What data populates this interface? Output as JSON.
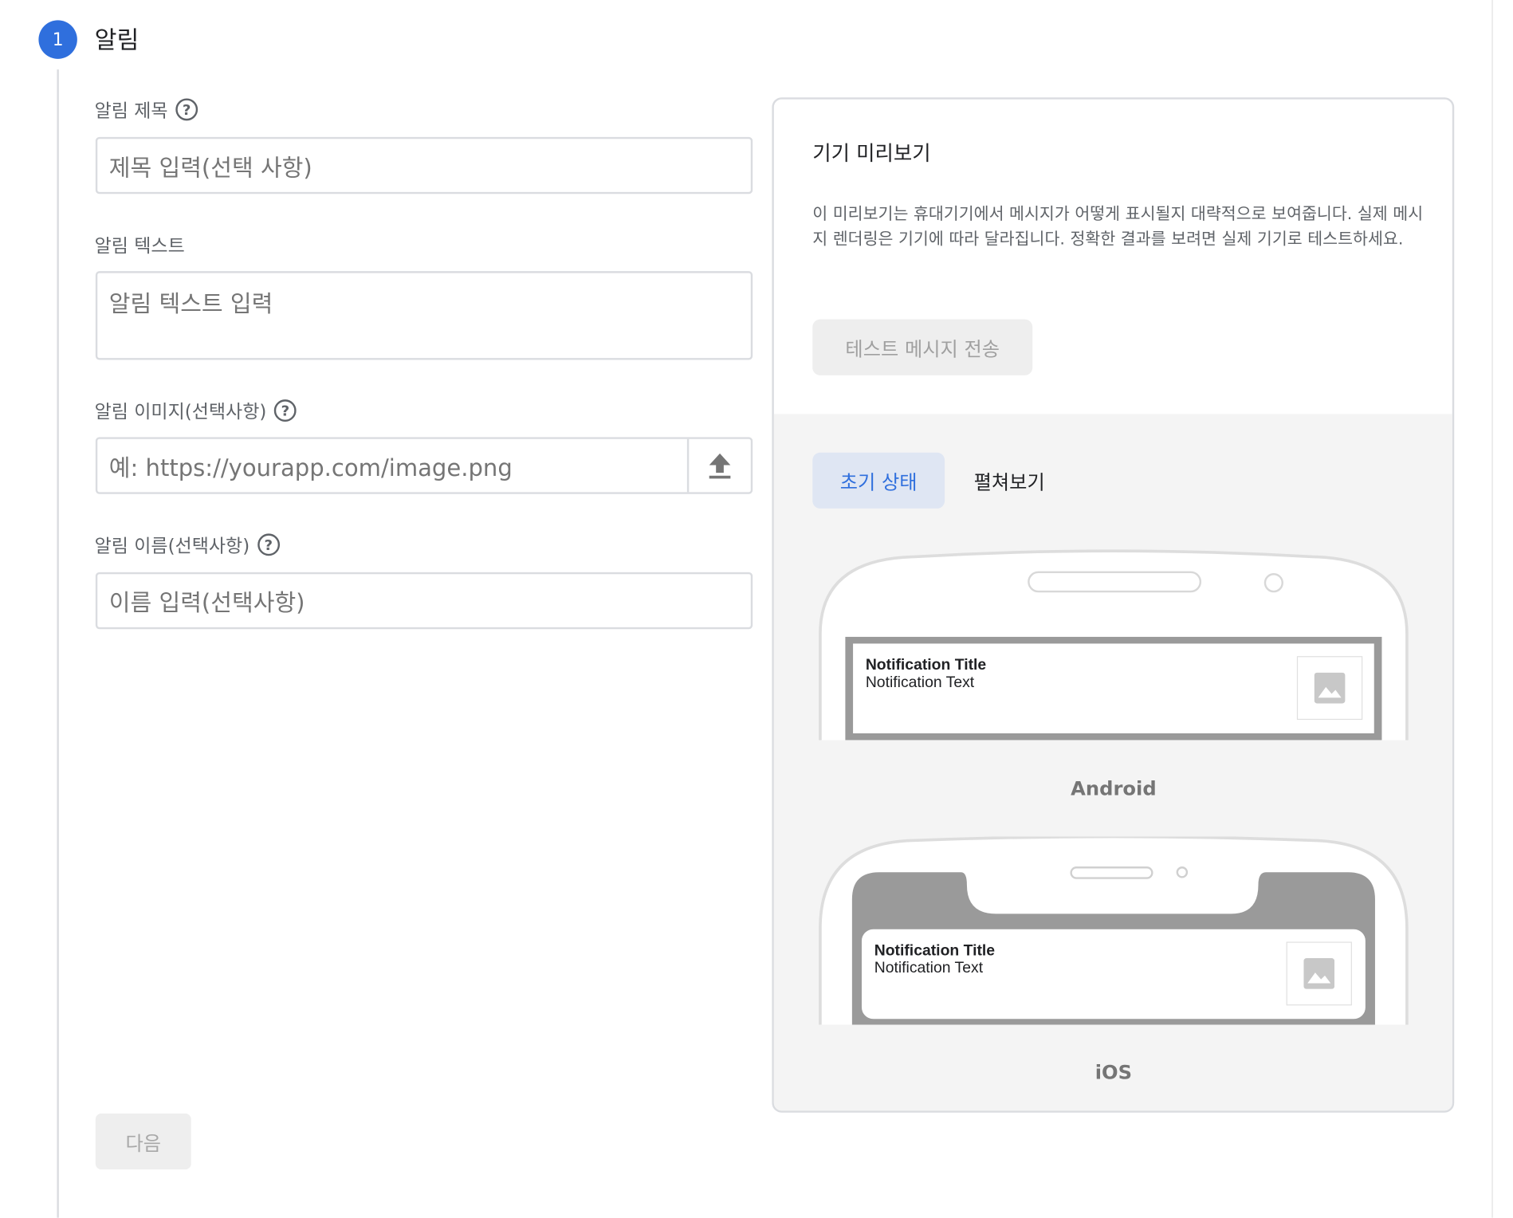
{
  "step": {
    "number": "1",
    "title": "알림"
  },
  "form": {
    "title_label": "알림 제목",
    "title_placeholder": "제목 입력(선택 사항)",
    "text_label": "알림 텍스트",
    "text_placeholder": "알림 텍스트 입력",
    "image_label": "알림 이미지(선택사항)",
    "image_placeholder": "예: https://yourapp.com/image.png",
    "name_label": "알림 이름(선택사항)",
    "name_placeholder": "이름 입력(선택사항)",
    "next_label": "다음"
  },
  "preview": {
    "title": "기기 미리보기",
    "description": "이 미리보기는 휴대기기에서 메시지가 어떻게 표시될지 대략적으로 보여줍니다. 실제 메시지 렌더링은 기기에 따라 달라집니다. 정확한 결과를 보려면 실제 기기로 테스트하세요.",
    "test_button": "테스트 메시지 전송",
    "tabs": [
      {
        "label": "초기 상태",
        "active": true
      },
      {
        "label": "펼쳐보기",
        "active": false
      }
    ],
    "android": {
      "notification_title": "Notification Title",
      "notification_text": "Notification Text",
      "label": "Android"
    },
    "ios": {
      "notification_title": "Notification Title",
      "notification_text": "Notification Text",
      "label": "iOS"
    }
  },
  "colors": {
    "accent": "#2f6fdd",
    "tab_active_bg": "#dfe6f3",
    "disabled_bg": "#eeeeee",
    "preview_bg": "#f4f4f4"
  },
  "icons": {
    "help": "help-circle-icon",
    "upload": "upload-icon",
    "image_placeholder": "image-icon"
  }
}
